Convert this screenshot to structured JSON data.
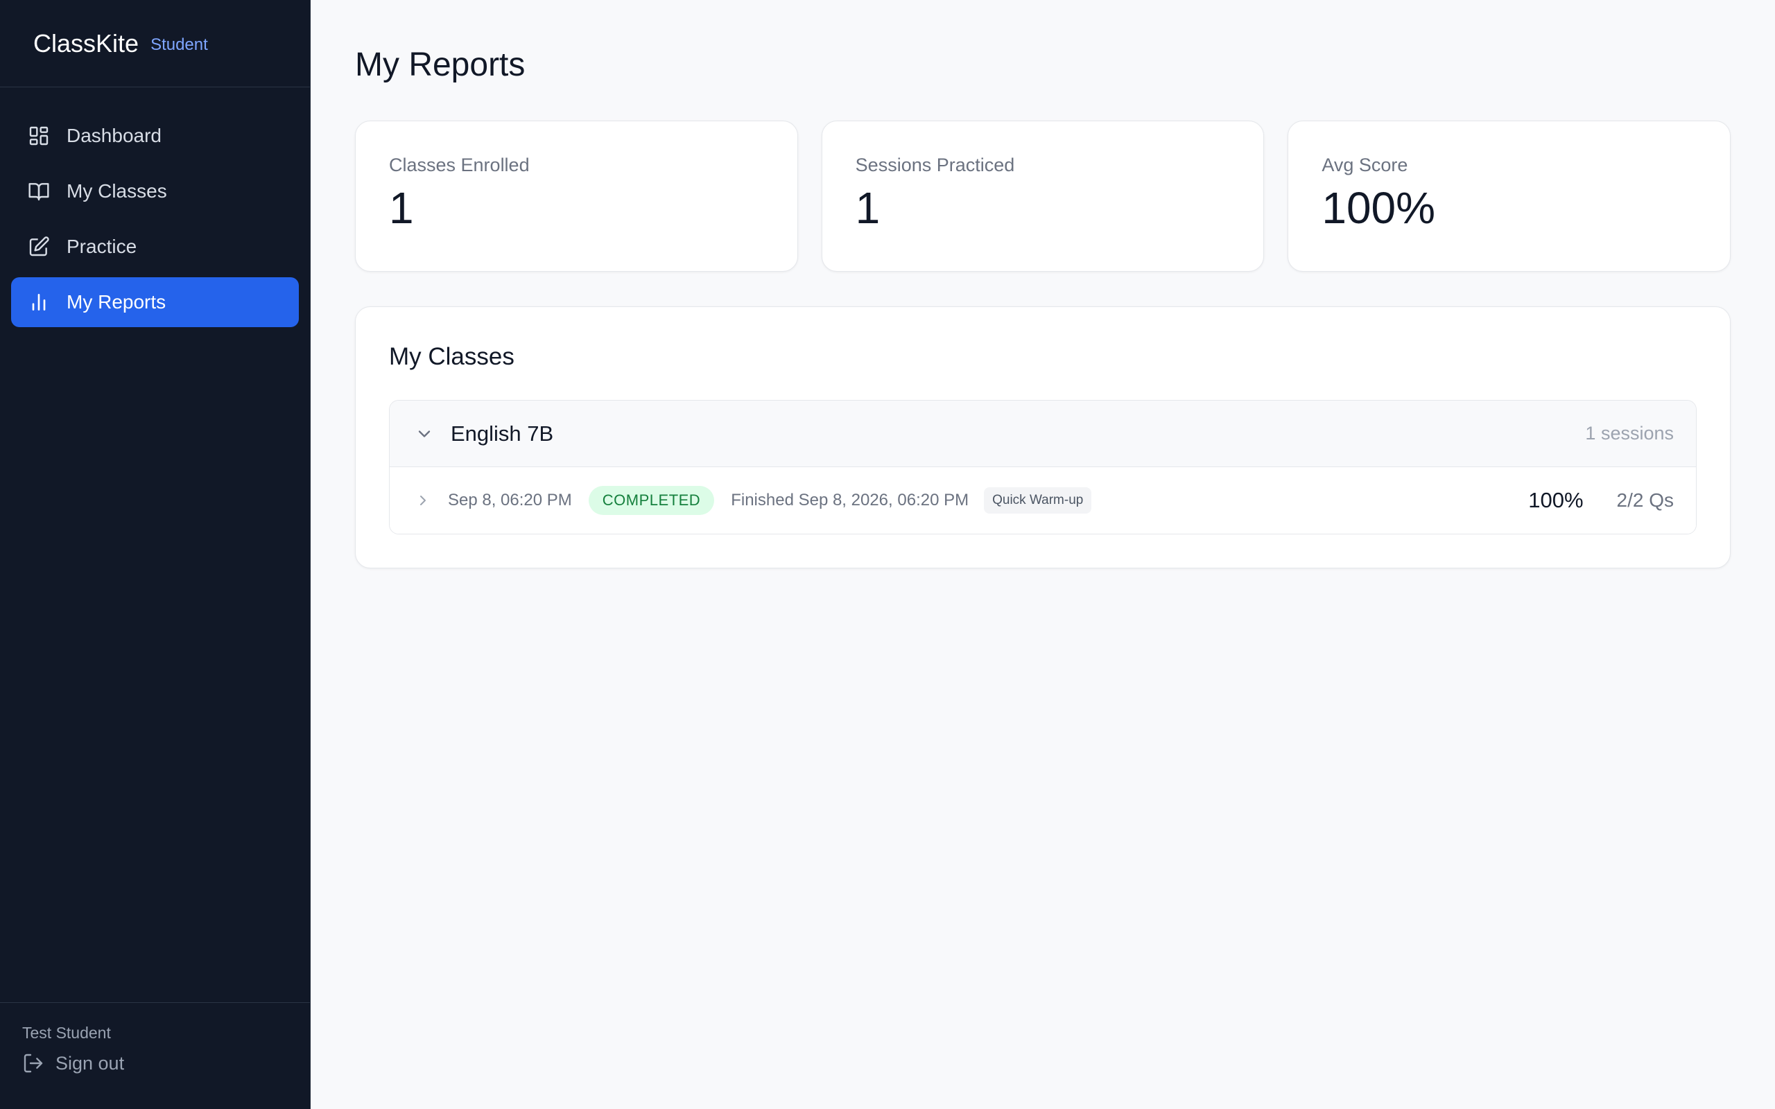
{
  "brand": {
    "name": "ClassKite",
    "role": "Student"
  },
  "nav": {
    "items": [
      {
        "label": "Dashboard",
        "icon": "dashboard-icon"
      },
      {
        "label": "My Classes",
        "icon": "book-icon"
      },
      {
        "label": "Practice",
        "icon": "edit-icon"
      },
      {
        "label": "My Reports",
        "icon": "bar-chart-icon",
        "active": true
      }
    ]
  },
  "footer": {
    "user_name": "Test Student",
    "signout_label": "Sign out"
  },
  "page": {
    "title": "My Reports"
  },
  "stats": [
    {
      "label": "Classes Enrolled",
      "value": "1"
    },
    {
      "label": "Sessions Practiced",
      "value": "1"
    },
    {
      "label": "Avg Score",
      "value": "100%"
    }
  ],
  "classes_panel": {
    "title": "My Classes",
    "groups": [
      {
        "name": "English 7B",
        "sessions_count": "1 sessions",
        "sessions": [
          {
            "date": "Sep 8, 06:20 PM",
            "status": "COMPLETED",
            "finished": "Finished Sep 8, 2026, 06:20 PM",
            "tag": "Quick Warm-up",
            "score": "100%",
            "questions": "2/2 Qs"
          }
        ]
      }
    ]
  },
  "colors": {
    "sidebar_bg": "#111827",
    "accent": "#2563eb",
    "completed_bg": "#dcfce7",
    "completed_text": "#15803d"
  }
}
